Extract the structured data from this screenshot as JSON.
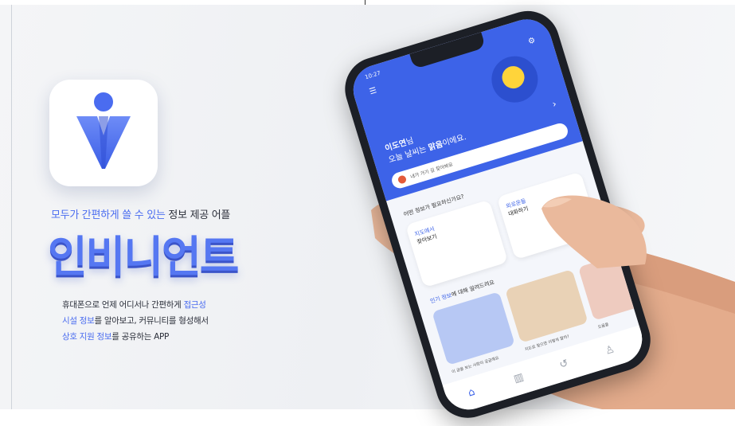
{
  "hero": {
    "tagline_prefix": "모두가 간편하게 쓸 수 있는",
    "tagline_suffix": " 정보 제공 어플",
    "brand_name": "인비니언트",
    "desc_line1_a": "휴대폰으로 언제 어디서나 간편하게 ",
    "desc_line1_b": "접근성",
    "desc_line2_a": "시설 정보",
    "desc_line2_b": "를 알아보고, 커뮤니티를 형성해서",
    "desc_line3_a": "상호 지원 정보",
    "desc_line3_b": "를 공유하는 APP"
  },
  "phone": {
    "status_time": "10:27",
    "greeting_name": "이도연",
    "greeting_suffix": "님",
    "greeting_line2_a": "오늘 날씨는 ",
    "greeting_line2_b": "맑음",
    "greeting_line2_c": "이에요.",
    "alert_text": "내가 가기 길 찾아봐요",
    "section1": "어떤 정보가 필요하신가요?",
    "card1_line1": "지도에서",
    "card1_line2": "찾아보기",
    "card2_line1": "외로운들",
    "card2_line2": "대화하기",
    "section2_blue": "인기 정보",
    "section2_rest": "에 대해 알려드려요",
    "tile1_caption": "이 글을 보는 사람이 궁금해요",
    "tile2_caption": "지도로 찾으면 어떻게 할까?",
    "tile3_caption": "도움을"
  },
  "colors": {
    "accent": "#4a6cf0",
    "screen_header": "#3d63e8"
  },
  "icons": [
    "menu-icon",
    "gear-icon",
    "home-icon",
    "map-icon",
    "history-icon",
    "user-icon"
  ]
}
